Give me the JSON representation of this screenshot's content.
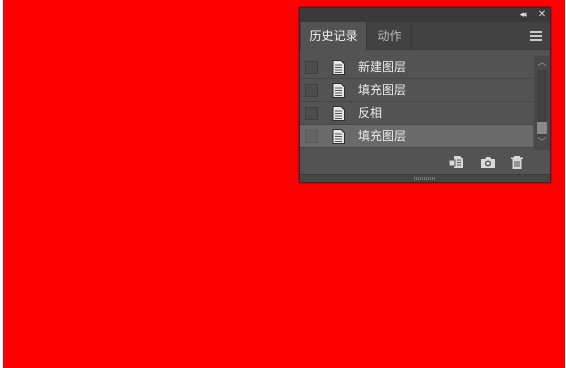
{
  "canvas": {
    "color": "#ff0000"
  },
  "panel": {
    "collapse_icon": "double-chevron-left-icon",
    "close_icon": "close-icon",
    "tabs": [
      {
        "label": "历史记录",
        "active": true
      },
      {
        "label": "动作",
        "active": false
      }
    ],
    "menu_icon": "hamburger-menu-icon",
    "history": [
      {
        "label": "新建图层",
        "icon": "document-icon",
        "selected": false
      },
      {
        "label": "填充图层",
        "icon": "document-icon",
        "selected": false
      },
      {
        "label": "反相",
        "icon": "document-icon",
        "selected": false
      },
      {
        "label": "填充图层",
        "icon": "document-icon",
        "selected": true
      }
    ],
    "footer_buttons": [
      {
        "name": "new-document-from-state-icon"
      },
      {
        "name": "camera-icon"
      },
      {
        "name": "trash-icon"
      }
    ]
  }
}
